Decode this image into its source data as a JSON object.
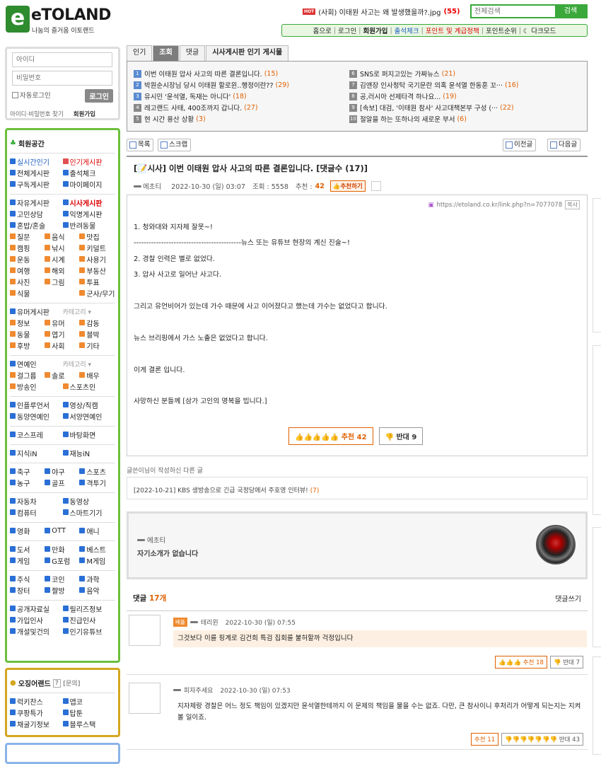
{
  "header": {
    "logo_mark": "e",
    "logo_text": "eTOLAND",
    "logo_sub": "나눔의 즐거움 이토랜드",
    "hot_badge": "HOT",
    "hot_title": "(사회) 이태원 사고는 왜 발생했을까?.jpg",
    "hot_count": "(55)",
    "search_placeholder": "전체검색",
    "search_button": "검색",
    "nav": [
      "홈으로",
      "로그인",
      "회원가입",
      "출석체크",
      "포인트 및 계급정책",
      "포인트순위",
      "☾ 다크모드"
    ]
  },
  "login": {
    "id_placeholder": "아이디",
    "pw_placeholder": "비밀번호",
    "auto_login": "자동로그인",
    "login_button": "로그인",
    "find": "아이디·비밀번호 찾기",
    "join": "회원가입"
  },
  "sidebar": {
    "title": "회원공간",
    "groups": [
      [
        [
          "실시간인기",
          "인기게시판"
        ],
        [
          "전체게시판",
          "출석체크"
        ],
        [
          "구독게시판",
          "마이페이지"
        ]
      ],
      [
        [
          "자유게시판",
          "시사게시판"
        ],
        [
          "고민상담",
          "익명게시판"
        ],
        [
          "혼밥/혼술",
          "반려동물"
        ],
        [
          "질문",
          "음식",
          "맛집"
        ],
        [
          "캠핑",
          "낚시",
          "키덜트"
        ],
        [
          "운동",
          "시계",
          "사용기"
        ],
        [
          "여행",
          "해외",
          "부동산"
        ],
        [
          "사진",
          "그림",
          "투표"
        ],
        [
          "식물",
          "",
          "군사/무기"
        ]
      ],
      [
        [
          "유머게시판",
          "카테고리 ▾"
        ],
        [
          "정보",
          "유머",
          "감동"
        ],
        [
          "동물",
          "엽기",
          "블박"
        ],
        [
          "후방",
          "사회",
          "기타"
        ]
      ],
      [
        [
          "연예인",
          "카테고리 ▾"
        ],
        [
          "걸그룹",
          "솔로",
          "배우"
        ],
        [
          "방송인",
          "스포츠인"
        ]
      ],
      [
        [
          "인플루언서",
          "영상/직캠"
        ],
        [
          "동양연예인",
          "서양연예인"
        ]
      ],
      [
        [
          "코스프레",
          "바탕화면"
        ]
      ],
      [
        [
          "지식iN",
          "재능iN"
        ]
      ],
      [
        [
          "축구",
          "야구",
          "스포츠"
        ],
        [
          "농구",
          "골프",
          "격투기"
        ]
      ],
      [
        [
          "자동차",
          "동영상"
        ],
        [
          "컴퓨터",
          "스마트기기"
        ]
      ],
      [
        [
          "영화",
          "OTT",
          "애니"
        ]
      ],
      [
        [
          "도서",
          "만화",
          "베스트"
        ],
        [
          "게임",
          "G포럼",
          "M게임"
        ]
      ],
      [
        [
          "주식",
          "코인",
          "과학"
        ],
        [
          "장터",
          "짤방",
          "음악"
        ]
      ],
      [
        [
          "공개자료실",
          "릴리즈정보"
        ],
        [
          "가입인사",
          "진급인사"
        ],
        [
          "개설및건의",
          "인기유튜브"
        ]
      ]
    ],
    "ojing_title": "오징어랜드",
    "ojing_help": "?",
    "ojing_inquiry": "[문의]",
    "ojing_rows": [
      [
        "럭키찬스",
        "앱코"
      ],
      [
        "쿠팡특가",
        "탑툰"
      ],
      [
        "채굴기정보",
        "블루스택"
      ]
    ]
  },
  "tabs": [
    "인기",
    "조회",
    "댓글",
    "시사게시판 인기 게시물"
  ],
  "popular_left": [
    {
      "n": "1",
      "t": "이번 이태원 압사 사고의 따른 결론입니다.",
      "c": "(15)"
    },
    {
      "n": "2",
      "t": "박원순시장님 당시 이태원 할로윈..행정이란??",
      "c": "(29)"
    },
    {
      "n": "3",
      "t": "유시민 '윤석열, 독재는 아니다'",
      "c": "(18)"
    },
    {
      "n": "4",
      "t": "레고랜드 사태, 400조까지 갑니다.",
      "c": "(27)"
    },
    {
      "n": "5",
      "t": "현 시간 용산 상황",
      "c": "(3)"
    }
  ],
  "popular_right": [
    {
      "n": "6",
      "t": "SNS로 퍼지고있는 가짜뉴스",
      "c": "(21)"
    },
    {
      "n": "7",
      "t": "김앤장 인사청탁 국기문란 의혹 윤석열 한동훈 꼬···",
      "c": "(16)"
    },
    {
      "n": "8",
      "t": "공,러시아 선제타격 하나요...",
      "c": "(19)"
    },
    {
      "n": "9",
      "t": "[속보] 대검, '이태원 참사' 사고대책본부 구성 (···",
      "c": "(22)"
    },
    {
      "n": "10",
      "t": "절알을 하는 또하나의 새로운 부서",
      "c": "(6)"
    }
  ],
  "toolbar": {
    "list": "목록",
    "scrap": "스크랩",
    "prev": "이전글",
    "next": "다음글"
  },
  "post": {
    "title": "[📝시사] 이번 이태원 압사 사고의 따른 결론입니다. [댓글수 (17)]",
    "author": "에초티",
    "date": "2022-10-30 (일) 03:07",
    "views": "조회 : 5558",
    "rec_label": "추천 :",
    "rec_value": "42",
    "rec_button": "👍추천하기",
    "link": "https://etoland.co.kr/link.php?n=7077078",
    "copy": "복사",
    "lines": [
      "1. 청와대와 지자체 잘못~!",
      "-------------------------------------------뉴스 또는 유튜브 현장의 계신 진술~!",
      "2. 경찰 인력은 별로 없었다.",
      "3. 압사 사고로 일어난 사고다.",
      "",
      "그리고 유언비어가 있는데 가수 때문에 사고 이어졌다고 했는데 가수는 없었다고 합니다.",
      "",
      "뉴스 브리핑에서 가스 노출은 없었다고 합니다.",
      "",
      "이게 결론 입니다.",
      "",
      "사망하신 분들께 [삼가 고인의 명복을 빕니다.]"
    ],
    "vote_up": "👍👍👍👍👍 추천 42",
    "vote_down": "👎 반대 9"
  },
  "other": {
    "heading": "글쓴이님이 작성하신 다른 글",
    "item": "[2022-10-21] KBS 생방송으로 긴급 국정당에서 주호영 인터뷰!",
    "count": "(7)"
  },
  "profile": {
    "name": "에초티",
    "intro": "자기소개가 없습니다"
  },
  "comments_head": {
    "label": "댓글",
    "count": "17개",
    "write": "댓글쓰기"
  },
  "comments": [
    {
      "best": "베플",
      "author": "테리윈",
      "date": "2022-10-30 (일) 07:55",
      "text": "그것보다 이를 핑계로 김건희 특검 집회를 불허할까 걱정입니다",
      "up": "👍👍👍 추천 18",
      "down": "👎 반대 7"
    },
    {
      "best": "",
      "author": "피자주세요",
      "date": "2022-10-30 (일) 07:53",
      "text": "지자체랑 경찰은 어느 정도 책임이 있겠지만 윤석열한테까지 이 문제의 책임을 물을 수는 없죠. 다만, 큰 참사이니 후처리가 어떻게 되는지는 지켜볼 일이죠.",
      "up": "추천 11",
      "down": "👎👎👎👎👎👎👎 반대 43"
    }
  ]
}
